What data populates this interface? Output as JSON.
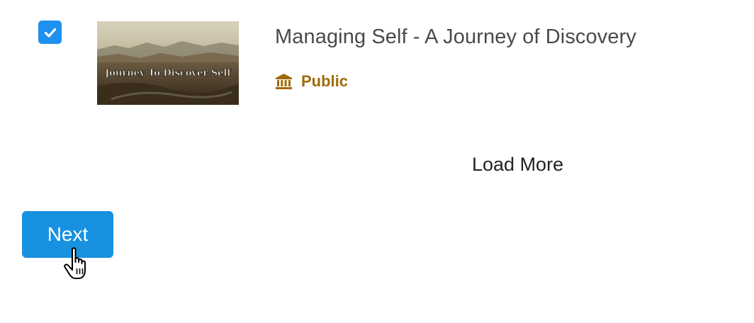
{
  "course": {
    "selected": true,
    "thumbnail_caption": "Journey To Discover Self",
    "title": "Managing Self - A Journey of Discovery",
    "visibility_icon": "bank-icon",
    "visibility_label": "Public",
    "visibility_color": "#a06a06"
  },
  "list": {
    "load_more_label": "Load More"
  },
  "footer": {
    "next_label": "Next",
    "next_color": "#1891e0"
  },
  "cursor": {
    "icon": "hand-pointer-icon"
  },
  "colors": {
    "checkbox": "#1e90ef",
    "title_text": "#4a4a4a",
    "link_text": "#222222"
  }
}
